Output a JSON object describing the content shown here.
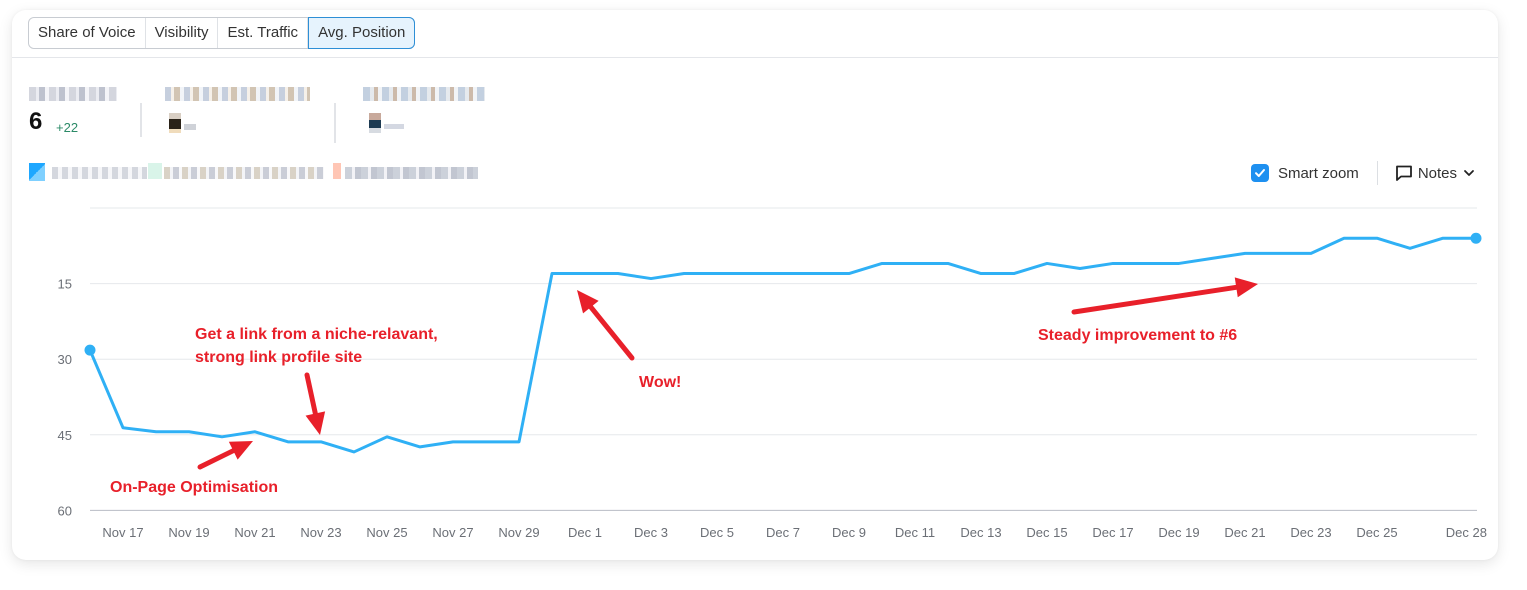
{
  "tabs": [
    {
      "label": "Share of Voice",
      "active": false
    },
    {
      "label": "Visibility",
      "active": false
    },
    {
      "label": "Est. Traffic",
      "active": false
    },
    {
      "label": "Avg. Position",
      "active": true
    }
  ],
  "metrics": [
    {
      "label": "[redacted]",
      "value": "6",
      "delta": "+22"
    },
    {
      "label": "[redacted]",
      "value": "[redacted]",
      "delta": ""
    },
    {
      "label": "[redacted]",
      "value": "[redacted]",
      "delta": ""
    }
  ],
  "legend": [
    "[redacted]",
    "[redacted]",
    "[redacted]"
  ],
  "controls": {
    "smart_zoom_label": "Smart zoom",
    "smart_zoom_checked": true,
    "notes_label": "Notes"
  },
  "colors": {
    "line": "#2fb0f5",
    "annotation": "#e8202a",
    "accent": "#1e90f0",
    "delta_positive": "#2b8a67"
  },
  "chart_data": {
    "type": "line",
    "title": "",
    "xlabel": "",
    "ylabel": "",
    "y_inverted": true,
    "ylim": [
      0,
      60
    ],
    "yticks": [
      15,
      30,
      45,
      60
    ],
    "grid": true,
    "x": [
      "Nov 16",
      "Nov 17",
      "Nov 18",
      "Nov 19",
      "Nov 20",
      "Nov 21",
      "Nov 22",
      "Nov 23",
      "Nov 24",
      "Nov 25",
      "Nov 26",
      "Nov 27",
      "Nov 28",
      "Nov 29",
      "Nov 30",
      "Dec 1",
      "Dec 2",
      "Dec 3",
      "Dec 4",
      "Dec 5",
      "Dec 6",
      "Dec 7",
      "Dec 8",
      "Dec 9",
      "Dec 10",
      "Dec 11",
      "Dec 12",
      "Dec 13",
      "Dec 14",
      "Dec 15",
      "Dec 16",
      "Dec 17",
      "Dec 18",
      "Dec 19",
      "Dec 20",
      "Dec 21",
      "Dec 22",
      "Dec 23",
      "Dec 24",
      "Dec 25",
      "Dec 26",
      "Dec 27",
      "Dec 28"
    ],
    "xtick_labels": [
      "Nov 17",
      "Nov 19",
      "Nov 21",
      "Nov 23",
      "Nov 25",
      "Nov 27",
      "Nov 29",
      "Dec 1",
      "Dec 3",
      "Dec 5",
      "Dec 7",
      "Dec 9",
      "Dec 11",
      "Dec 13",
      "Dec 15",
      "Dec 17",
      "Dec 19",
      "Dec 21",
      "Dec 23",
      "Dec 25",
      "Dec 28"
    ],
    "series": [
      {
        "name": "Avg. Position",
        "values": [
          28.2,
          43.6,
          44.4,
          44.4,
          45.4,
          44.4,
          46.4,
          46.4,
          48.4,
          45.4,
          47.4,
          46.4,
          46.4,
          46.4,
          13,
          13,
          13,
          14,
          13,
          13,
          13,
          13,
          13,
          13,
          11,
          11,
          11,
          13,
          13,
          11,
          12,
          11,
          11,
          11,
          10,
          9,
          9,
          9,
          6,
          6,
          8,
          6,
          6
        ]
      }
    ],
    "annotations": [
      {
        "text": "On-Page Optimisation",
        "points_to": "Nov 21"
      },
      {
        "text": "Get a link from a niche-relavant,",
        "text2": "strong link profile site",
        "points_to": "Nov 23"
      },
      {
        "text": "Wow!",
        "points_to": "Dec 1"
      },
      {
        "text": "Steady improvement to #6",
        "points_to": "Dec 21"
      }
    ]
  }
}
